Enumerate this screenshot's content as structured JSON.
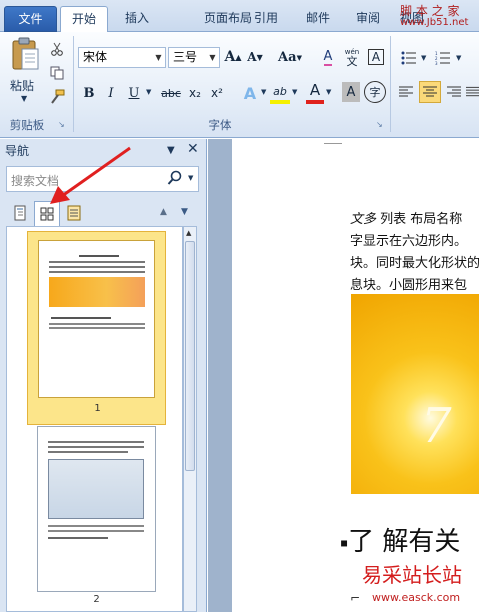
{
  "tabs": {
    "file": "文件",
    "home": "开始",
    "insert": "插入",
    "page_layout": "页面布局",
    "references": "引用",
    "mailings": "邮件",
    "review": "审阅",
    "view_partial": "视图"
  },
  "watermark_top": {
    "line1": "脚 本 之 家",
    "line2": "www.Jb51.net"
  },
  "clipboard": {
    "paste": "粘贴",
    "label": "剪贴板"
  },
  "font": {
    "name": "宋体",
    "size": "三号",
    "label": "字体",
    "grow": "A",
    "shrink": "A",
    "change_case": "Aa",
    "clear": "A",
    "phonetic_label": "wén",
    "border_char": "A",
    "bold": "B",
    "italic": "I",
    "underline": "U",
    "strike": "abc",
    "sub": "x₂",
    "sup": "x²",
    "effects": "A",
    "highlight": "ab",
    "color": "A",
    "shading": "A",
    "enclose": "字"
  },
  "navigation": {
    "title": "导航",
    "search_placeholder": "搜索文档",
    "thumb_page_numbers": [
      "1",
      "2"
    ]
  },
  "document": {
    "line1_italic": "文多",
    "line1_rest": "列表 布局名称",
    "line2": "字显示在六边形内。",
    "line3": "块。同时最大化形状的",
    "line4": "息块。小圆形用来包",
    "heading": "了 解有关",
    "logo_lines": [
      "易采站长站",
      "www.easck.com"
    ]
  },
  "colors": {
    "accent_orange": "#f5b800",
    "arrow": "#e02020",
    "file_tab": "#2a5caa",
    "nav_bg": "#dae5f3"
  }
}
